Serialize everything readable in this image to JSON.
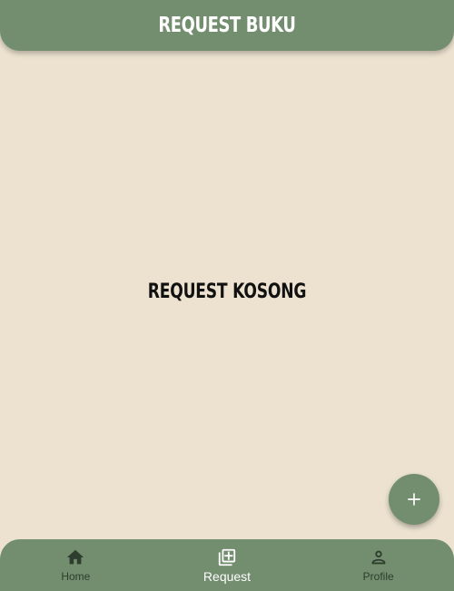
{
  "app_bar": {
    "title": "REQUEST BUKU"
  },
  "main": {
    "empty_message": "REQUEST KOSONG"
  },
  "fab": {
    "icon": "plus-icon"
  },
  "bottom_nav": {
    "items": [
      {
        "label": "Home",
        "icon": "home-icon",
        "active": false
      },
      {
        "label": "Request",
        "icon": "library-add-icon",
        "active": true
      },
      {
        "label": "Profile",
        "icon": "person-icon",
        "active": false
      }
    ]
  },
  "colors": {
    "background": "#ece2cf",
    "primary": "#728e6f",
    "active_label": "#ffffff",
    "inactive": "#2f3d2e"
  }
}
